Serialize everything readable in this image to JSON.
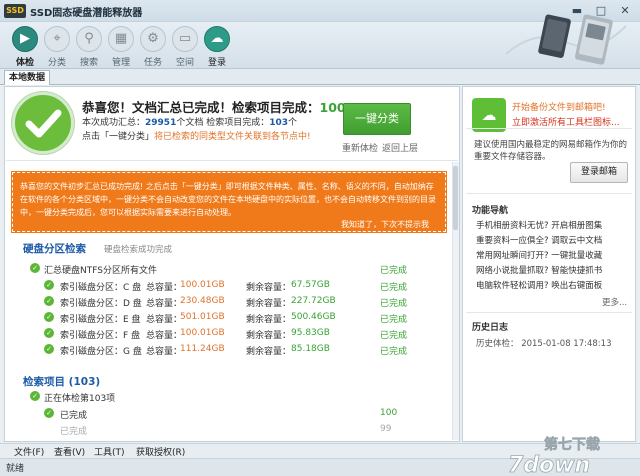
{
  "window": {
    "title": "SSD固态硬盘潜能释放器",
    "app_icon_text": "SSD",
    "controls": {
      "minimize": "▬",
      "maximize": "□",
      "close": "✕"
    }
  },
  "toolbar": {
    "items": [
      {
        "label": "体检",
        "icon": "play-icon",
        "glyph": "▶"
      },
      {
        "label": "分类",
        "icon": "location-pin-icon",
        "glyph": "⌖"
      },
      {
        "label": "搜索",
        "icon": "search-icon",
        "glyph": "⚲"
      },
      {
        "label": "管理",
        "icon": "grid-icon",
        "glyph": "▦"
      },
      {
        "label": "任务",
        "icon": "gear-icon",
        "glyph": "⚙"
      },
      {
        "label": "空间",
        "icon": "id-card-icon",
        "glyph": "▭"
      },
      {
        "label": "登录",
        "icon": "cloud-icon",
        "glyph": "☁"
      }
    ]
  },
  "tabs": {
    "local_data": "本地数据"
  },
  "summary": {
    "title": "恭喜您！文档汇总已完成！检索项目完成：",
    "percent": "100 %",
    "line2_prefix": "本次成功汇总：",
    "line2_count": "29951",
    "line2_mid": "个文档  检索项目完成：",
    "line2_items": "103",
    "line2_suffix": "个",
    "line3_prefix": "点击「一键分类」",
    "line3_orange": "将已检索的同类型文件关联到各节点中!",
    "classify_button": "一键分类",
    "reclassify_link": "重新体检",
    "back_link": "返回上层"
  },
  "notice": {
    "text": "恭喜您的文件初步汇总已成功完成! 之后点击「一键分类」即可根据文件种类、属性、名称、语义的不同，自动加纳存在软件的各个分类区域中，一键分类不会自动改变您的文件在本地硬盘中的实际位置，也不会自动转移文件到别的目录中，一键分类完成后，您可以根据实际需要来进行自动处理。",
    "close_text": "我知道了，下次不提示我"
  },
  "partition_section": {
    "title": "硬盘分区检索",
    "subtitle": "硬盘检索成功完成",
    "header_label": "汇总硬盘NTFS分区所有文件",
    "header_status": "已完成",
    "total_label": "总容量：",
    "remain_label": "剩余容量：",
    "rows": [
      {
        "name": "索引磁盘分区：C 盘",
        "total": "100.01GB",
        "remain": "67.57GB",
        "status": "已完成"
      },
      {
        "name": "索引磁盘分区：D 盘",
        "total": "230.48GB",
        "remain": "227.72GB",
        "status": "已完成"
      },
      {
        "name": "索引磁盘分区：E 盘",
        "total": "501.01GB",
        "remain": "500.46GB",
        "status": "已完成"
      },
      {
        "name": "索引磁盘分区：F 盘",
        "total": "100.01GB",
        "remain": "95.83GB",
        "status": "已完成"
      },
      {
        "name": "索引磁盘分区：G 盘",
        "total": "111.24GB",
        "remain": "85.18GB",
        "status": "已完成"
      }
    ]
  },
  "scan_section": {
    "title": "检索项目 (103)",
    "progress_label": "正在体检第103项",
    "sub_label": "已完成",
    "sub_value": "100",
    "sub2_label": "已完成",
    "sub2_value": "99"
  },
  "right_panel": {
    "promo_line1": "开始备份文件到邮箱吧!",
    "promo_line2": "立即激活所有工具栏图标...",
    "mail_desc": "建议使用国内最稳定的网易邮箱作为你的重要文件存储容器。",
    "login_mail_button": "登录邮箱",
    "func_nav_title": "功能导航",
    "nav_links": [
      "手机相册资料无忧? 开启相册图集",
      "重要资料一应俱全? 调取云中文档",
      "常用网址瞬间打开? 一键批量收藏",
      "网络小说批量抓取? 智能快捷抓书",
      "电脑软件轻松调用? 唤出右键面板"
    ],
    "more_link": "更多...",
    "history_title": "历史日志",
    "history_entry": "历史体检：  2015-01-08  17:48:13"
  },
  "menubar": {
    "items": [
      "文件(F)",
      "查看(V)",
      "工具(T)",
      "获取授权(R)"
    ]
  },
  "status": {
    "text": "就绪"
  },
  "watermark": {
    "text": "第七下载",
    "sub": "7down"
  },
  "colors": {
    "accent_green": "#3aa335",
    "accent_orange": "#e0732a",
    "link_blue": "#1d5aa8",
    "notice_orange": "#f07a1a"
  }
}
